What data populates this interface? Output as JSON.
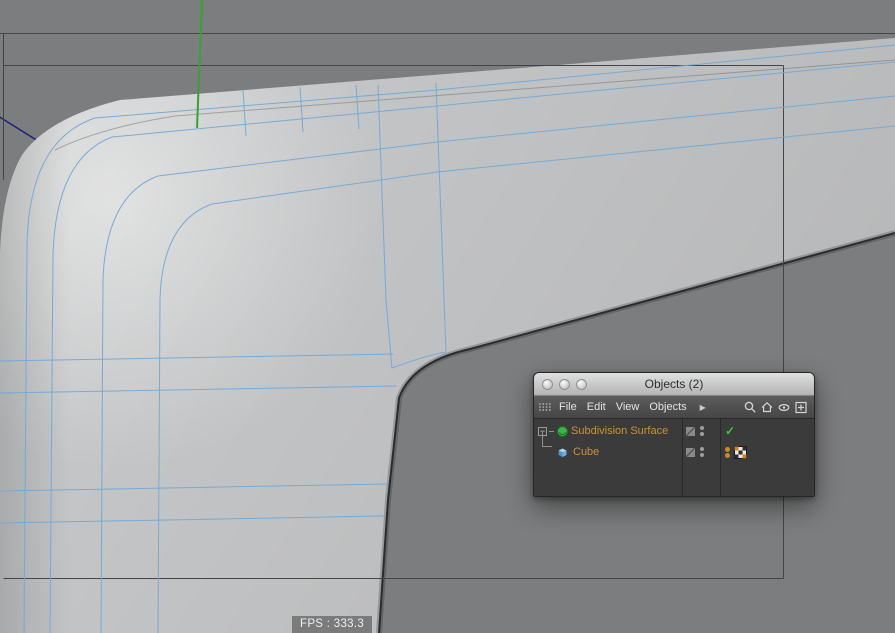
{
  "viewport": {
    "fps_label": "FPS : 333.3",
    "background_color": "#7c7d7e",
    "object_color": "#c9cacb",
    "wireframe_color": "#72a9d8",
    "axis_y_color": "#36a136",
    "axis_z_color": "#20207a",
    "safe_frame_color": "#454545"
  },
  "objects_panel": {
    "title": "Objects (2)",
    "window_buttons": [
      "window-button-1",
      "window-button-2",
      "window-button-3"
    ],
    "menu": {
      "items": [
        "File",
        "Edit",
        "View",
        "Objects"
      ],
      "overflow_arrow": "▶"
    },
    "toolbar_icons": [
      "search",
      "home",
      "eye",
      "add"
    ],
    "tree": {
      "rows": [
        {
          "label": "Subdivision Surface",
          "icon": "subdivision-surface",
          "expander": "−",
          "tags": [
            "enabled-checkmark"
          ],
          "check_glyph": "✓"
        },
        {
          "label": "Cube",
          "icon": "cube",
          "tags": [
            "material-dots",
            "texture-checkerboard"
          ]
        }
      ]
    },
    "colors": {
      "label_orange": "#ca9240",
      "check_green": "#3dc93d",
      "tag_orange": "#cd8728",
      "panel_body": "#3b3b3b"
    }
  }
}
